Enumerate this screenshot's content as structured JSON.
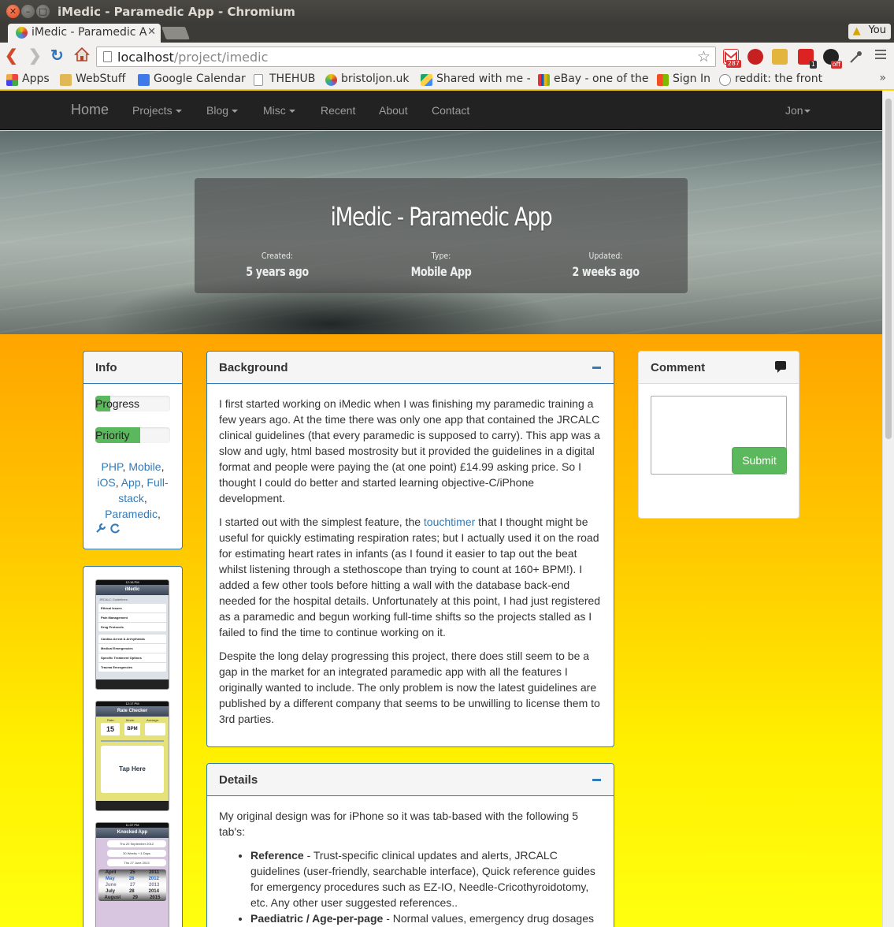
{
  "window": {
    "title": "iMedic - Paramedic App - Chromium"
  },
  "tab": {
    "label": "iMedic - Paramedic A",
    "user": "You"
  },
  "url": {
    "host": "localhost",
    "path": "/project/imedic"
  },
  "extensions": {
    "gmail_count": "287",
    "toggle_badge": "1",
    "off_badge": "off"
  },
  "bookmarks": [
    {
      "label": "Apps"
    },
    {
      "label": "WebStuff"
    },
    {
      "label": "Google Calendar"
    },
    {
      "label": "THEHUB"
    },
    {
      "label": "bristoljon.uk"
    },
    {
      "label": "Shared with me -"
    },
    {
      "label": "eBay - one of the"
    },
    {
      "label": "Sign In"
    },
    {
      "label": "reddit: the front"
    }
  ],
  "nav": {
    "brand": "Home",
    "links": [
      "Projects",
      "Blog",
      "Misc",
      "Recent",
      "About",
      "Contact"
    ],
    "user": "Jon"
  },
  "hero": {
    "title": "iMedic - Paramedic App",
    "created_label": "Created:",
    "created_value": "5 years ago",
    "type_label": "Type:",
    "type_value": "Mobile App",
    "updated_label": "Updated:",
    "updated_value": "2 weeks ago"
  },
  "info": {
    "title": "Info",
    "progress_label": "Progress",
    "progress_value": 0.2,
    "priority_label": "Priority",
    "priority_value": 0.6,
    "tags": [
      "PHP",
      "Mobile",
      "iOS",
      "App",
      "Full-stack",
      "Paramedic"
    ]
  },
  "screens": [
    {
      "time": "12:16 PM",
      "title": "iMedic",
      "subtitle": "JRCALC Guidelines:",
      "rows": [
        "Ethical Issues",
        "Pain Management",
        "Drug Protocols",
        "Cardiac Arrest & Arrhythmias",
        "Medical Emergencies",
        "Specific Treatment Options",
        "Trauma Emergencies"
      ]
    },
    {
      "time": "12:17 PM",
      "title": "Rate Checker",
      "rate_label": "Rate:",
      "mode_label": "Mode:",
      "avg_label": "Average:",
      "rate": "15",
      "mode": "BPM",
      "tap": "Tap Here"
    },
    {
      "time": "11:37 PM",
      "title": "Knocked App",
      "lmp": "Thu 20 September 2012",
      "weeks": "30 Weeks + 4 Days",
      "edd": "Thu 27 June 2013",
      "wheel": [
        [
          "April",
          "25",
          "2011"
        ],
        [
          "May",
          "26",
          "2012"
        ],
        [
          "June",
          "27",
          "2013"
        ],
        [
          "July",
          "28",
          "2014"
        ],
        [
          "August",
          "29",
          "2015"
        ]
      ]
    }
  ],
  "background": {
    "title": "Background",
    "p1": "I first started working on iMedic when I was finishing my paramedic training a few years ago. At the time there was only one app that contained the JRCALC clinical guidelines (that every paramedic is supposed to carry). This app was a slow and ugly, html based mostrosity but it provided the guidelines in a digital format and people were paying the (at one point) £14.99 asking price. So I thought I could do better and started learning objective-C/iPhone development.",
    "p2_before": "I started out with the simplest feature, the ",
    "p2_link": "touchtimer",
    "p2_after": " that I thought might be useful for quickly estimating respiration rates; but I actually used it on the road for estimating heart rates in infants (as I found it easier to tap out the beat whilst listening through a stethoscope than trying to count at 160+ BPM!). I added a few other tools before hitting a wall with the database back-end needed for the hospital details. Unfortunately at this point, I had just registered as a paramedic and begun working full-time shifts so the projects stalled as I failed to find the time to continue working on it.",
    "p3": "Despite the long delay progressing this project, there does still seem to be a gap in the market for an integrated paramedic app with all the features I originally wanted to include. The only problem is now the latest guidelines are published by a different company that seems to be unwilling to license them to 3rd parties."
  },
  "details": {
    "title": "Details",
    "intro": "My original design was for iPhone so it was tab-based with the following 5 tab's:",
    "items": [
      {
        "name": "Reference",
        "text": " - Trust-specific clinical updates and alerts, JRCALC guidelines (user-friendly, searchable interface), Quick reference guides for emergency procedures such as EZ-IO, Needle-Cricothyroidotomy, etc. Any other user suggested references.."
      },
      {
        "name": "Paediatric / Age-per-page",
        "text": " - Normal values, emergency drug dosages"
      }
    ]
  },
  "comment": {
    "title": "Comment",
    "submit": "Submit"
  },
  "colors": {
    "accent": "#337ab7",
    "success": "#5cb85c",
    "navbar": "#222222",
    "bg_top": "#ffa500",
    "bg_bottom": "#ffff10"
  }
}
